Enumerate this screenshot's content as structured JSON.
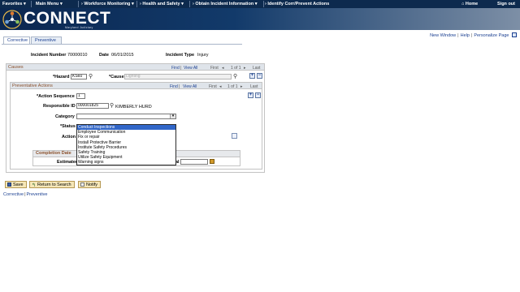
{
  "topnav": {
    "favorites": "Favorites",
    "main_menu": "Main Menu",
    "workforce": "Workforce Monitoring",
    "health_safety": "Health and Safety",
    "obtain_info": "Obtain Incident Information",
    "identify": "Identify Corr/Prevent Actions",
    "home": "Home",
    "sign_out": "Sign out"
  },
  "logo": {
    "text": "CONNECT",
    "subtitle": "Maryland Judiciary"
  },
  "util_links": {
    "new_window": "New Window",
    "help": "Help",
    "personalize": "Personalize Page",
    "sep": "|"
  },
  "tabs": {
    "corrective": "Corrective",
    "preventive": "Preventive"
  },
  "incident": {
    "number_label": "Incident Number",
    "number_value": "70000010",
    "date_label": "Date",
    "date_value": "06/01/2015",
    "type_label": "Incident Type",
    "type_value": "Injury"
  },
  "causes": {
    "title": "Causes",
    "find": "Find",
    "sep": "|",
    "view_all": "View All",
    "first": "First",
    "count": "1 of 1",
    "last": "Last",
    "hazard_label": "*Hazard",
    "hazard_value": "KS60",
    "cause_label": "*Cause",
    "cause_value": "Lighting",
    "add": "+",
    "remove": "−"
  },
  "actions": {
    "title": "Preventative Actions",
    "find": "Find",
    "sep": "|",
    "view_all": "View All",
    "first": "First",
    "count": "1 of 1",
    "last": "Last",
    "seq_label": "*Action Sequence",
    "seq_value": "1",
    "resp_label": "Responsible ID",
    "resp_value": "000001825",
    "resp_name": "KIMBERLY HURD",
    "category_label": "Category",
    "category_value": "",
    "status_label": "*Status",
    "action_label": "Action",
    "completion_title": "Completion Date",
    "estimated_label": "Estimated",
    "actual_label": "al",
    "add": "+",
    "remove": "−"
  },
  "category_options": [
    "Conduct Inspections",
    "Employee Communication",
    "Fix or repair",
    "Install Protective Barrier",
    "Institute Safety Procedures",
    "Safety Training",
    "Utilize Safety Equipment",
    "Warning signs"
  ],
  "buttons": {
    "save": "Save",
    "return": "Return to Search",
    "notify": "Notify"
  },
  "bottom_links": {
    "corrective": "Corrective",
    "sep": "|",
    "preventive": "Preventive"
  },
  "colors": {
    "nav_bg": "#0d2a4e",
    "link": "#1a3f91",
    "group_title": "#8a4f2a",
    "selected": "#3166c8"
  }
}
